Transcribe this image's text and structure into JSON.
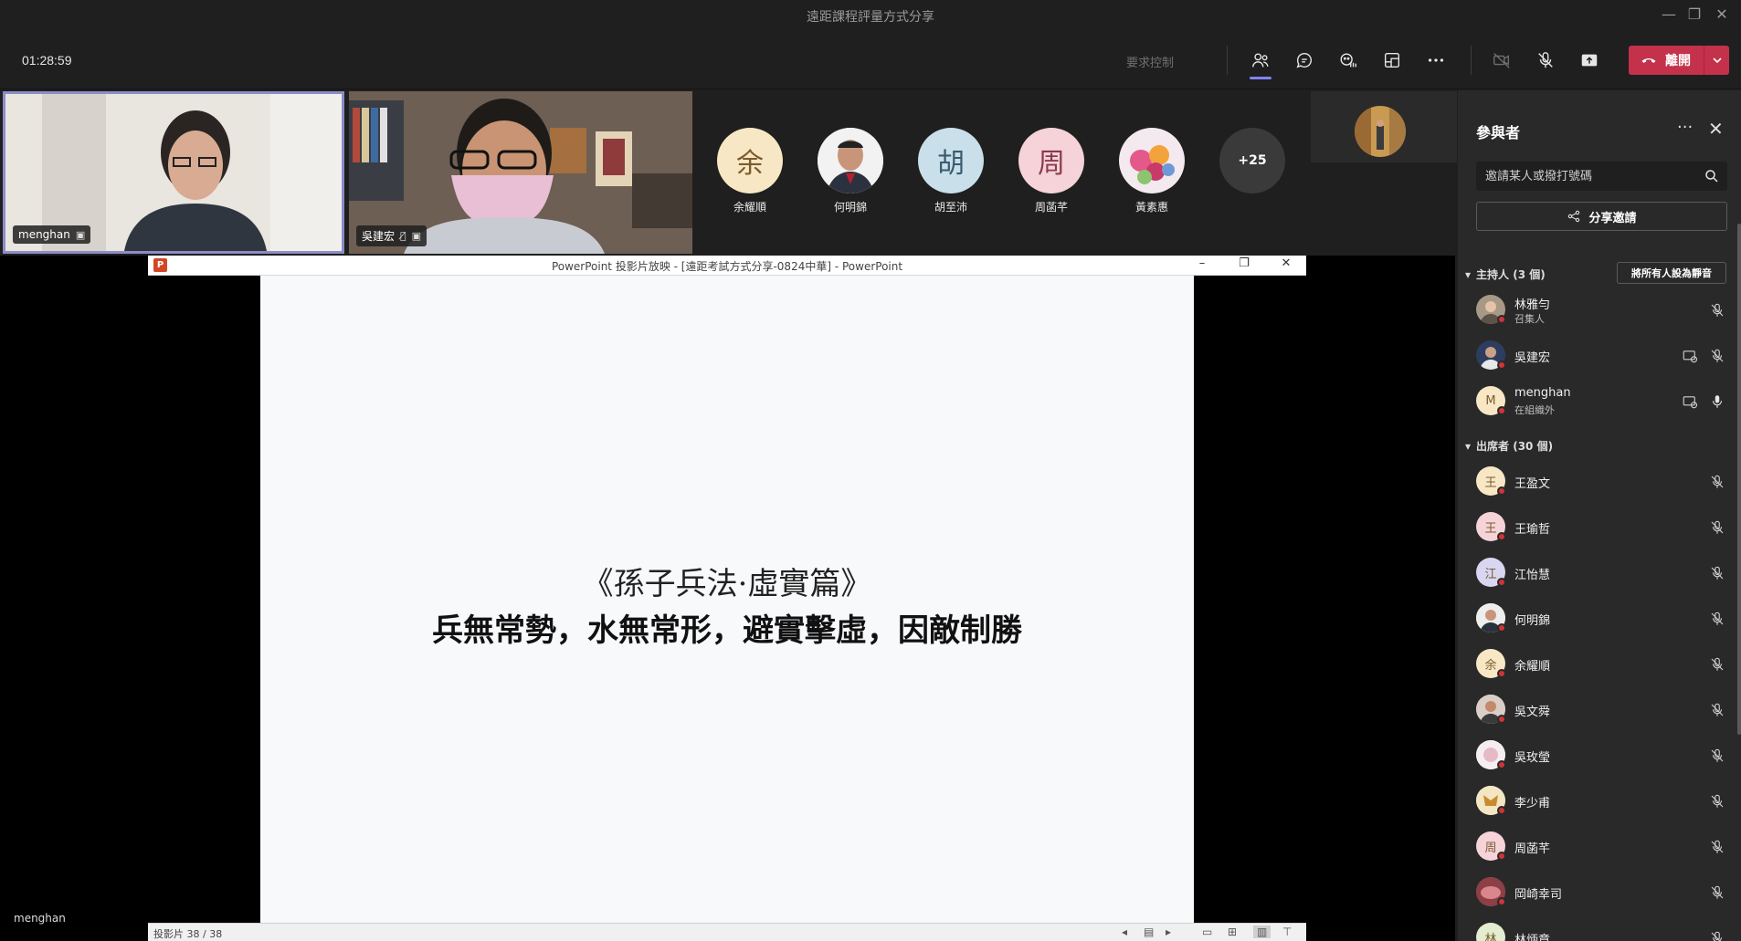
{
  "window": {
    "title": "遠距課程評量方式分享"
  },
  "toolbar": {
    "timer": "01:28:59",
    "request_control": "要求控制",
    "leave_label": "離開"
  },
  "videos": [
    {
      "name": "menghan"
    },
    {
      "name": "吳建宏"
    }
  ],
  "avatars": [
    {
      "name": "余耀順",
      "initial": "余",
      "color": "#f8e7c5"
    },
    {
      "name": "何明錦",
      "initial": "",
      "color": "#d9dde3"
    },
    {
      "name": "胡至沛",
      "initial": "胡",
      "color": "#c9dfe9"
    },
    {
      "name": "周菡芊",
      "initial": "周",
      "color": "#f6d3d8"
    },
    {
      "name": "黃素惠",
      "initial": "",
      "color": "#e8c9d6"
    }
  ],
  "more_count": "+25",
  "ppt": {
    "window_title": "PowerPoint 投影片放映 - [遠距考試方式分享-0824中華] - PowerPoint",
    "slide_line1": "《孫子兵法·虛實篇》",
    "slide_line2": "兵無常勢，水無常形，避實擊虛，因敵制勝",
    "status": "投影片 38 / 38"
  },
  "stage_name": "menghan",
  "panel": {
    "title": "參與者",
    "invite_placeholder": "邀請某人或撥打號碼",
    "share_invite": "分享邀請",
    "mute_all": "將所有人設為靜音",
    "hosts_header": "主持人 (3 個)",
    "attendees_header": "出席者 (30 個)",
    "hosts": [
      {
        "name": "林雅勻",
        "role": "召集人",
        "initial": "",
        "color": "#8a7a6a"
      },
      {
        "name": "吳建宏",
        "role": "",
        "initial": "",
        "color": "#3e5070"
      },
      {
        "name": "menghan",
        "role": "在組織外",
        "initial": "M",
        "color": "#f8e7c5"
      }
    ],
    "attendees": [
      {
        "name": "王盈文",
        "initial": "王",
        "color": "#f8e7c5"
      },
      {
        "name": "王瑜哲",
        "initial": "王",
        "color": "#f6d3d8"
      },
      {
        "name": "江怡慧",
        "initial": "江",
        "color": "#d8d6f0"
      },
      {
        "name": "何明錦",
        "initial": "",
        "color": "#d9dde3"
      },
      {
        "name": "余耀順",
        "initial": "余",
        "color": "#f8e7c5"
      },
      {
        "name": "吳文舜",
        "initial": "",
        "color": "#c9b8a8"
      },
      {
        "name": "吳玫瑩",
        "initial": "",
        "color": "#f0e6ea"
      },
      {
        "name": "李少甫",
        "initial": "",
        "color": "#f2e2b8"
      },
      {
        "name": "周菡芊",
        "initial": "周",
        "color": "#f6d3d8"
      },
      {
        "name": "岡崎幸司",
        "initial": "",
        "color": "#a8525a"
      },
      {
        "name": "林炳章",
        "initial": "林",
        "color": "#e3edd0"
      }
    ]
  }
}
